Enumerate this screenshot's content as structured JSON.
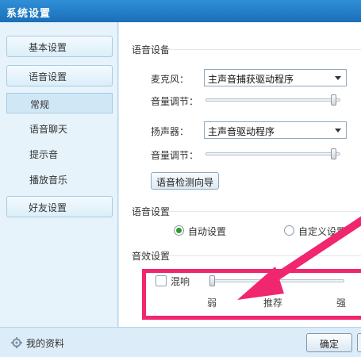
{
  "window": {
    "title": "系统设置"
  },
  "sidebar": {
    "items": [
      {
        "label": "基本设置",
        "kind": "main"
      },
      {
        "label": "语音设置",
        "kind": "main"
      },
      {
        "label": "常规",
        "kind": "sub",
        "active": true
      },
      {
        "label": "语音聊天",
        "kind": "sub"
      },
      {
        "label": "提示音",
        "kind": "sub"
      },
      {
        "label": "播放音乐",
        "kind": "sub"
      },
      {
        "label": "好友设置",
        "kind": "main"
      }
    ]
  },
  "voice_device": {
    "section_title": "语音设备",
    "mic_label": "麦克风：",
    "mic_value": "主声音捕获驱动程序",
    "mic_volume_label": "音量调节：",
    "mic_volume": 0.97,
    "speaker_label": "扬声器：",
    "speaker_value": "主声音驱动程序",
    "speaker_volume_label": "音量调节：",
    "speaker_volume": 0.97,
    "wizard_button": "语音检测向导"
  },
  "voice_settings": {
    "section_title": "语音设置",
    "options": [
      {
        "label": "自动设置",
        "selected": true
      },
      {
        "label": "自定义设置",
        "selected": false
      }
    ]
  },
  "sound_effects": {
    "section_title": "音效设置",
    "reverb_label": "混响",
    "reverb_checked": false,
    "reverb_level": 0.0,
    "scale": {
      "low": "弱",
      "mid": "推荐",
      "high": "强"
    }
  },
  "footer": {
    "profile_link": "我的资料",
    "ok_button": "确定"
  },
  "colors": {
    "title_bar": "#1f7cc6",
    "sidebar_bg": "#e6f3fb",
    "radio_selected": "#2c9b2c",
    "annotation": "#f0266f"
  },
  "icons": [
    "gear-icon",
    "dropdown-arrow-icon"
  ]
}
